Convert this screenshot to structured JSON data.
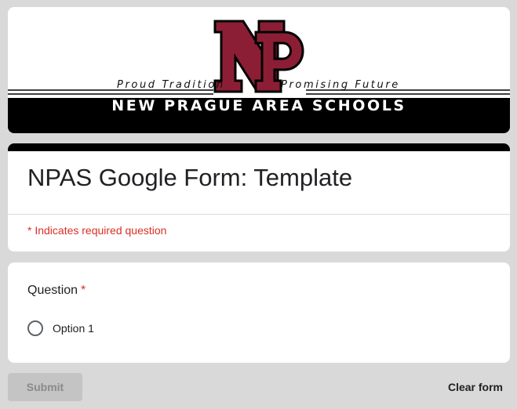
{
  "banner": {
    "logo_letters": "NP",
    "tagline_left": "Proud Tradition",
    "tagline_right": "Promising Future",
    "school_name": "NEW PRAGUE AREA SCHOOLS",
    "brand_maroon": "#8b1e35",
    "bar_color": "#000000"
  },
  "form": {
    "title": "NPAS Google Form: Template",
    "required_note": "* Indicates required question"
  },
  "question": {
    "label": "Question",
    "required_marker": "*",
    "options": [
      {
        "label": "Option 1",
        "selected": false
      }
    ]
  },
  "actions": {
    "submit_label": "Submit",
    "clear_label": "Clear form"
  },
  "colors": {
    "page_bg": "#d9d9d9",
    "required_red": "#d93025",
    "text": "#202124"
  }
}
